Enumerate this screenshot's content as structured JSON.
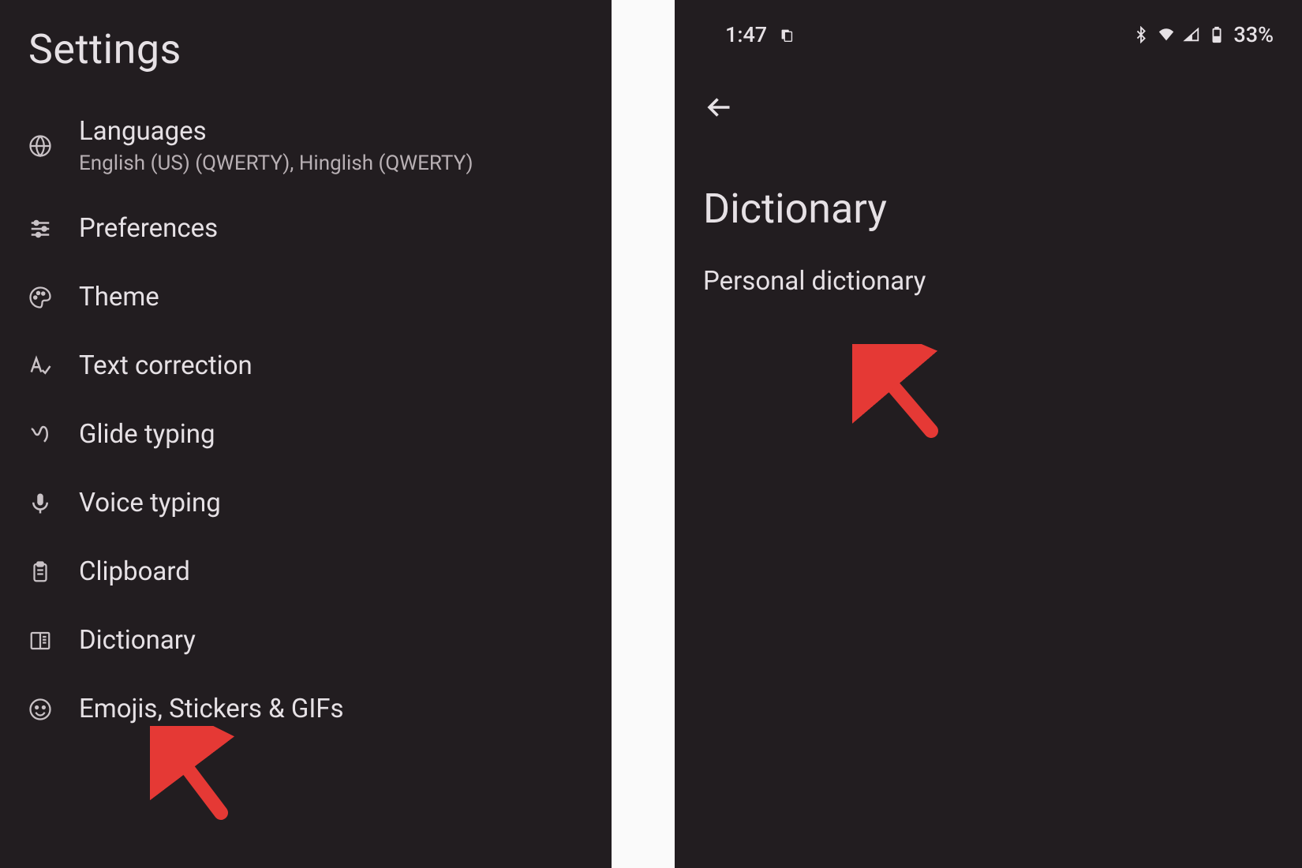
{
  "left": {
    "title": "Settings",
    "items": [
      {
        "icon": "globe-icon",
        "label": "Languages",
        "subtitle": "English (US) (QWERTY), Hinglish (QWERTY)"
      },
      {
        "icon": "sliders-icon",
        "label": "Preferences"
      },
      {
        "icon": "palette-icon",
        "label": "Theme"
      },
      {
        "icon": "text-correction-icon",
        "label": "Text correction"
      },
      {
        "icon": "gesture-icon",
        "label": "Glide typing"
      },
      {
        "icon": "mic-icon",
        "label": "Voice typing"
      },
      {
        "icon": "clipboard-icon",
        "label": "Clipboard"
      },
      {
        "icon": "book-icon",
        "label": "Dictionary"
      },
      {
        "icon": "emoji-icon",
        "label": "Emojis, Stickers & GIFs"
      }
    ]
  },
  "right": {
    "status": {
      "time": "1:47",
      "battery": "33%"
    },
    "title": "Dictionary",
    "items": [
      {
        "label": "Personal dictionary"
      }
    ]
  }
}
